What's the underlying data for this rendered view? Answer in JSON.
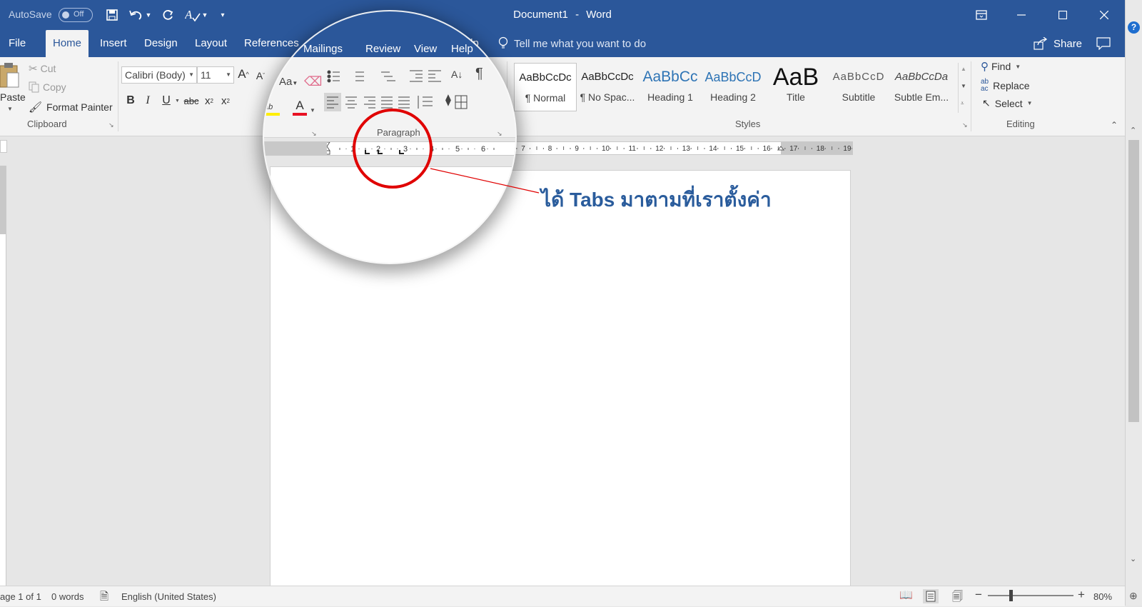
{
  "titlebar": {
    "autosave_label": "AutoSave",
    "autosave_state": "Off",
    "doc_title": "Document1",
    "title_sep": "-",
    "app_name": "Word",
    "help_badge": "?"
  },
  "tabs": [
    "File",
    "Home",
    "Insert",
    "Design",
    "Layout",
    "References",
    "Mailings",
    "Review",
    "View",
    "Help"
  ],
  "active_tab": "Home",
  "tell_me": "Tell me what you want to do",
  "share_label": "Share",
  "clipboard": {
    "paste": "Paste",
    "cut": "Cut",
    "copy": "Copy",
    "format_painter": "Format Painter",
    "label": "Clipboard"
  },
  "font": {
    "name": "Calibri (Body)",
    "size": "11",
    "change_case": "Aa",
    "label": "Font",
    "bold": "B",
    "italic": "I",
    "underline": "U",
    "strike": "abc",
    "subscript": "x",
    "superscript": "x",
    "sub_mark": "2",
    "sup_mark": "2",
    "grow": "A",
    "shrink": "A",
    "text_effects": "A",
    "highlight": "ab",
    "font_color": "A"
  },
  "paragraph": {
    "label": "Paragraph",
    "pilcrow": "¶"
  },
  "styles": {
    "label": "Styles",
    "items": [
      {
        "preview": "AaBbCcDc",
        "name": "¶ Normal"
      },
      {
        "preview": "AaBbCcDc",
        "name": "¶ No Spac..."
      },
      {
        "preview": "AaBbCc",
        "name": "Heading 1"
      },
      {
        "preview": "AaBbCcD",
        "name": "Heading 2"
      },
      {
        "preview": "AaB",
        "name": "Title"
      },
      {
        "preview": "AaBbCcD",
        "name": "Subtitle"
      },
      {
        "preview": "AaBbCcDa",
        "name": "Subtle Em..."
      }
    ]
  },
  "editing": {
    "find": "Find",
    "replace": "Replace",
    "select": "Select",
    "label": "Editing"
  },
  "ruler": {
    "labels": [
      "2",
      "1",
      "1",
      "2",
      "3",
      "4",
      "5",
      "6",
      "7",
      "8",
      "9",
      "10",
      "11",
      "12",
      "13",
      "14",
      "15",
      "16",
      "17",
      "18",
      "19"
    ]
  },
  "annotation": {
    "callout": "ได้ Tabs มาตามที่เราตั้งค่า"
  },
  "statusbar": {
    "page": "age 1 of 1",
    "words": "0 words",
    "language": "English (United States)",
    "zoom": "80%",
    "zoom_level": 0.8
  },
  "colors": {
    "accent": "#2b579a",
    "callout": "#2a5c9c",
    "circle": "#e00000"
  }
}
